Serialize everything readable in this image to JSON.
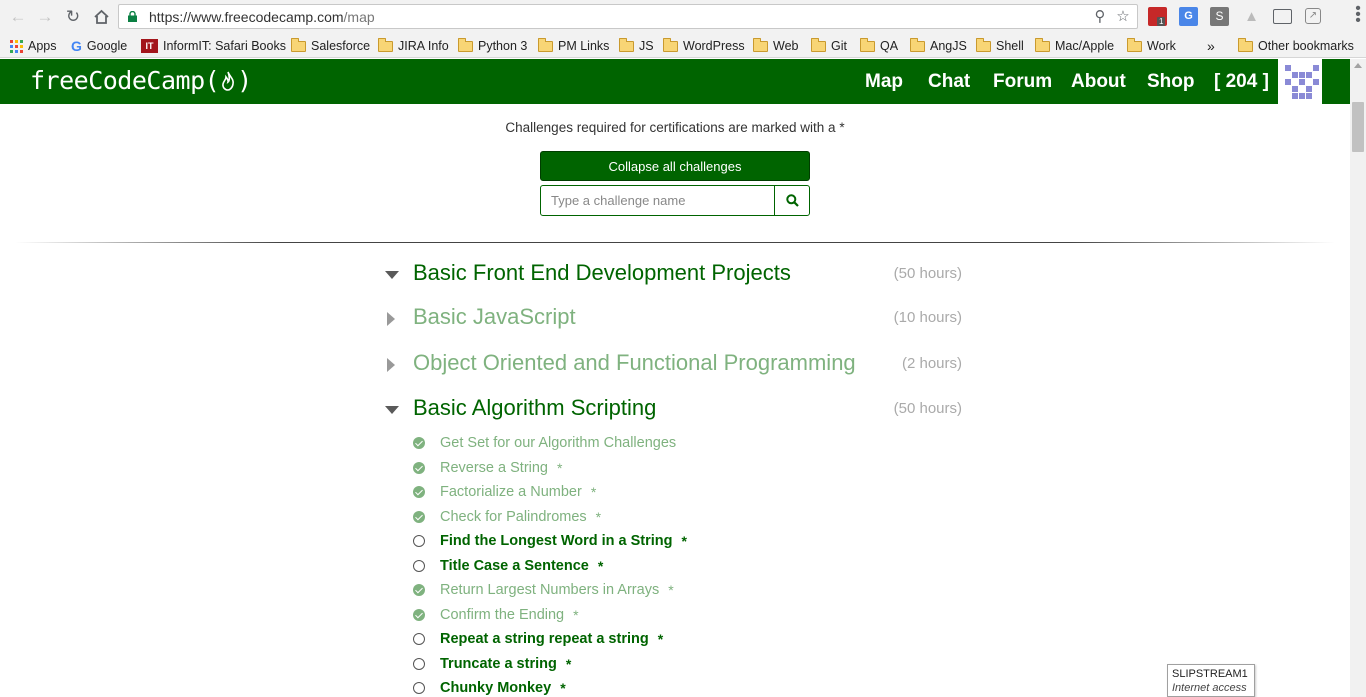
{
  "browser": {
    "url_host": "https://www.freecodecamp.com",
    "url_path": "/map",
    "extension_badge": "1",
    "bookmarks": [
      {
        "label": "Apps",
        "icon": "apps-grid-icon"
      },
      {
        "label": "Google",
        "icon": "google-icon"
      },
      {
        "label": "InformIT: Safari Books",
        "icon": "informit-icon"
      },
      {
        "label": "Salesforce",
        "icon": "folder-icon"
      },
      {
        "label": "JIRA Info",
        "icon": "folder-icon"
      },
      {
        "label": "Python 3",
        "icon": "folder-icon"
      },
      {
        "label": "PM Links",
        "icon": "folder-icon"
      },
      {
        "label": "JS",
        "icon": "folder-icon"
      },
      {
        "label": "WordPress",
        "icon": "folder-icon"
      },
      {
        "label": "Web",
        "icon": "folder-icon"
      },
      {
        "label": "Git",
        "icon": "folder-icon"
      },
      {
        "label": "QA",
        "icon": "folder-icon"
      },
      {
        "label": "AngJS",
        "icon": "folder-icon"
      },
      {
        "label": "Shell",
        "icon": "folder-icon"
      },
      {
        "label": "Mac/Apple",
        "icon": "folder-icon"
      },
      {
        "label": "Work",
        "icon": "folder-icon"
      }
    ],
    "overflow_label": "»",
    "other_bookmarks": "Other bookmarks"
  },
  "fcc": {
    "logo_text": "freeCodeCamp(",
    "logo_close": ")",
    "nav": [
      "Map",
      "Chat",
      "Forum",
      "About",
      "Shop"
    ],
    "points": "[ 204 ]",
    "brand_color": "#006400"
  },
  "map": {
    "cert_note": "Challenges required for certifications are marked with a *",
    "collapse_label": "Collapse all challenges",
    "search_placeholder": "Type a challenge name",
    "blocks": [
      {
        "title": "Basic Front End Development Projects",
        "hours": "(50 hours)",
        "expanded": true,
        "style": "active"
      },
      {
        "title": "Basic JavaScript",
        "hours": "(10 hours)",
        "expanded": false,
        "style": "faded"
      },
      {
        "title": "Object Oriented and Functional Programming",
        "hours": "(2 hours)",
        "expanded": false,
        "style": "faded"
      },
      {
        "title": "Basic Algorithm Scripting",
        "hours": "(50 hours)",
        "expanded": true,
        "style": "active"
      }
    ],
    "challenges": [
      {
        "name": "Get Set for our Algorithm Challenges",
        "completed": true,
        "required": false
      },
      {
        "name": "Reverse a String",
        "completed": true,
        "required": true
      },
      {
        "name": "Factorialize a Number",
        "completed": true,
        "required": true
      },
      {
        "name": "Check for Palindromes",
        "completed": true,
        "required": true
      },
      {
        "name": "Find the Longest Word in a String",
        "completed": false,
        "required": true
      },
      {
        "name": "Title Case a Sentence",
        "completed": false,
        "required": true
      },
      {
        "name": "Return Largest Numbers in Arrays",
        "completed": true,
        "required": true
      },
      {
        "name": "Confirm the Ending",
        "completed": true,
        "required": true
      },
      {
        "name": "Repeat a string repeat a string",
        "completed": false,
        "required": true
      },
      {
        "name": "Truncate a string",
        "completed": false,
        "required": true
      },
      {
        "name": "Chunky Monkey",
        "completed": false,
        "required": true
      }
    ],
    "required_mark": "*"
  },
  "network_tooltip": {
    "name": "SLIPSTREAM1",
    "status": "Internet access"
  }
}
